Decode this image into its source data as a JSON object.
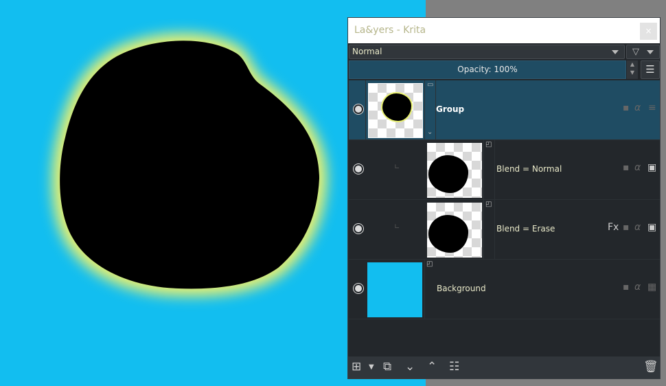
{
  "window": {
    "title": "La&yers - Krita",
    "close": "×"
  },
  "blend_mode": {
    "value": "Normal"
  },
  "filter": {
    "icon": "filter-icon"
  },
  "opacity": {
    "label": "Opacity:  100%"
  },
  "layers": [
    {
      "name": "Group",
      "type": "group",
      "selected": true
    },
    {
      "name": "Blend = Normal",
      "type": "paint",
      "selected": false
    },
    {
      "name": "Blend = Erase",
      "type": "paint",
      "selected": false,
      "badge": "Fx"
    },
    {
      "name": "Background",
      "type": "paint",
      "selected": false
    }
  ],
  "colors": {
    "canvas": "#12bef0",
    "selection": "#1f4c63",
    "panel": "#23272b"
  }
}
